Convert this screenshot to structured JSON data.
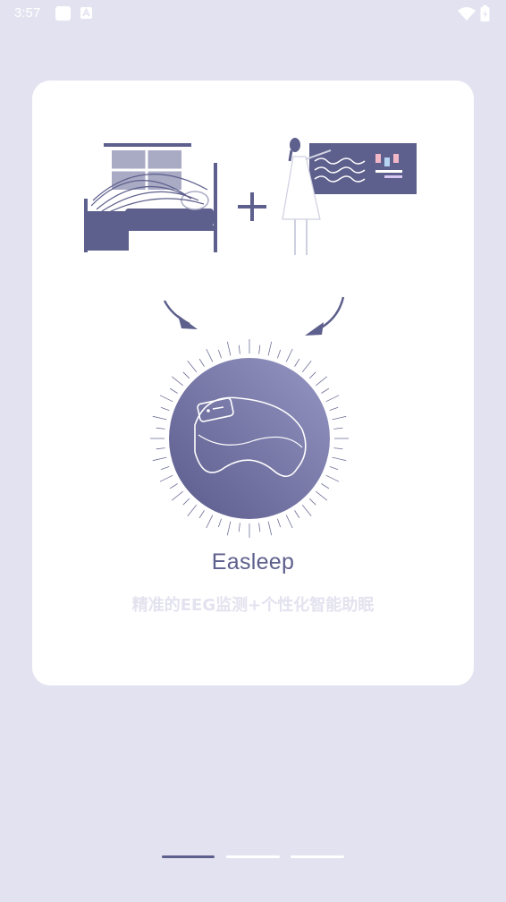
{
  "status_bar": {
    "time": "3:57",
    "icons": [
      "notification-square-icon",
      "notification-a-icon",
      "wifi-icon",
      "battery-icon"
    ]
  },
  "onboarding": {
    "app_name": "Easleep",
    "tagline": "精准的EEG监测+个性化智能助眠"
  },
  "pager": {
    "page_count": 3,
    "active_index": 0
  },
  "colors": {
    "background": "#e3e2f0",
    "card": "#ffffff",
    "accent": "#5d5f8c",
    "pager_active": "#5d5f8c",
    "pager_inactive": "#ffffff"
  }
}
